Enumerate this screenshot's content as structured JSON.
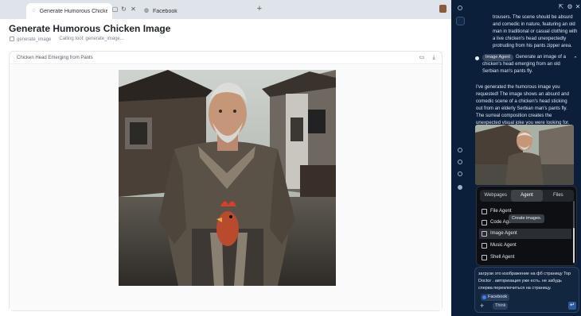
{
  "browser": {
    "tabs": [
      {
        "label": "Generate Humorous Chicken I…",
        "icon": "loading-icon",
        "active": true
      },
      {
        "label": "Facebook",
        "icon": "globe-icon",
        "active": false
      }
    ],
    "new_tab_label": "+"
  },
  "page": {
    "title": "Generate Humorous Chicken Image",
    "meta_tool": "generate_image",
    "meta_status": "Calling tool: generate_image...",
    "card_title": "Chicken Head Emerging from Pants"
  },
  "chat": {
    "intro_text": "trousers. The scene should be absurd and comedic in nature, featuring an old man in traditional or casual clothing with a live chicken's head unexpectedly protruding from his pants zipper area.",
    "agent_badge": "Image Agent",
    "agent_request": "Generate an image of a chicken's head emerging from an old Serbian man's pants fly.",
    "reply_text": "I've generated the humorous image you requested! The image shows an absurd and comedic scene of a chicken's head sticking out from an elderly Serbian man's pants fly. The surreal composition creates the unexpected visual joke you were looking for."
  },
  "agent_popup": {
    "tabs": [
      "Webpages",
      "Agent",
      "Files"
    ],
    "active_tab": "Agent",
    "items": [
      {
        "label": "File Agent"
      },
      {
        "label": "Code Agent"
      },
      {
        "label": "Image Agent"
      },
      {
        "label": "Music Agent"
      },
      {
        "label": "Shell Agent"
      }
    ],
    "tooltip": "Create images."
  },
  "composer": {
    "text": "загрузи это изображение на фб страницу Top Doctor . авторизация уже есть. не забудь сперва переключиться на страницу.",
    "chip_facebook": "Facebook",
    "chip_think": "Think",
    "send_icon": "send-icon"
  },
  "colors": {
    "panel_bg": "#0b1f3a",
    "popup_bg": "#0e0f12",
    "accent": "#2f5a9a"
  }
}
